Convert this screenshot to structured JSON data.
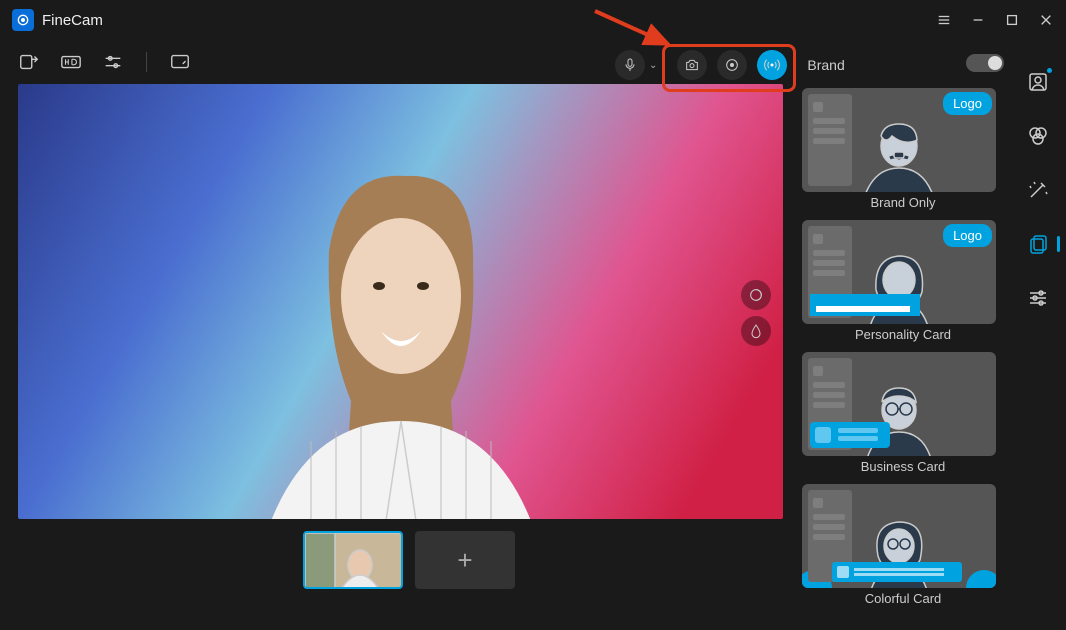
{
  "app": {
    "title": "FineCam"
  },
  "brand": {
    "panel_label": "Brand",
    "logo_badge": "Logo",
    "cards": [
      {
        "label": "Brand Only"
      },
      {
        "label": "Personality Card"
      },
      {
        "label": "Business Card"
      },
      {
        "label": "Colorful Card"
      }
    ]
  },
  "scenes": {
    "add_symbol": "+"
  },
  "colors": {
    "accent": "#00a3e0",
    "highlight_border": "#e03c1e"
  }
}
